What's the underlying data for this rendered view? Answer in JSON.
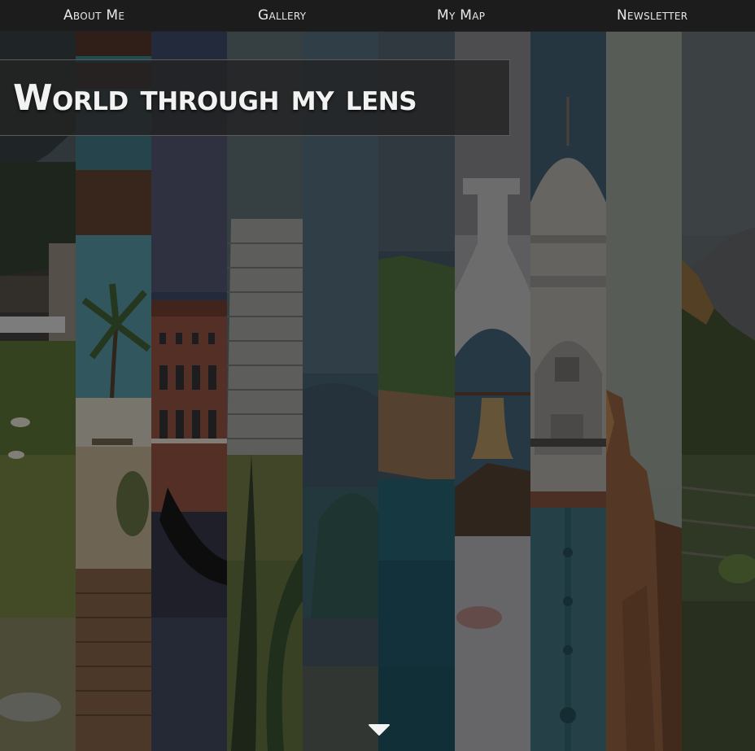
{
  "nav": {
    "items": [
      {
        "label": "About Me"
      },
      {
        "label": "Gallery"
      },
      {
        "label": "My Map"
      },
      {
        "label": "Newsletter"
      }
    ]
  },
  "hero": {
    "title": "World through my lens"
  },
  "strips": [
    {
      "scene": "farm-pasture"
    },
    {
      "scene": "palm-beach-pier"
    },
    {
      "scene": "venice-canal"
    },
    {
      "scene": "mayan-pyramid"
    },
    {
      "scene": "misty-lake-island"
    },
    {
      "scene": "coastal-cliff"
    },
    {
      "scene": "church-bell-arch"
    },
    {
      "scene": "taj-mahal"
    },
    {
      "scene": "red-rock-canyon"
    },
    {
      "scene": "machu-picchu"
    }
  ],
  "icons": {
    "scroll": "caret-down-icon"
  },
  "colors": {
    "nav_background": "#1c1c1c",
    "nav_text": "#e8e8e8",
    "title_text": "#f2f2f2",
    "title_box": "#232323"
  }
}
